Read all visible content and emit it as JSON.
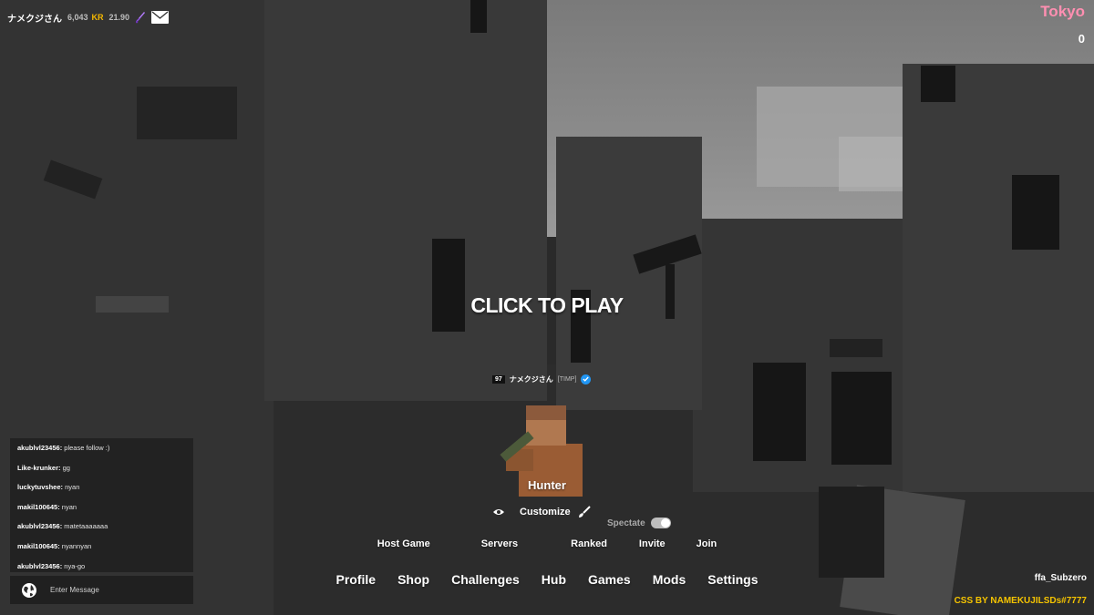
{
  "account": {
    "name": "ナメクジさん",
    "level": "6,043",
    "kr_label": "KR",
    "kr_value": "21.90",
    "icons": [
      "dagger-icon",
      "mail-icon"
    ]
  },
  "region": "Tokyo",
  "score": "0",
  "center": {
    "click_to_play": "CLICK TO PLAY",
    "player_level": "97",
    "player_name": "ナメクジさん",
    "player_clan": "[TIMP]",
    "class_name": "Hunter",
    "customize_label": "Customize",
    "spectate_label": "Spectate"
  },
  "sub_menu": [
    "Host Game",
    "Servers",
    "Ranked",
    "Invite",
    "Join"
  ],
  "main_menu": [
    "Profile",
    "Shop",
    "Challenges",
    "Hub",
    "Games",
    "Mods",
    "Settings"
  ],
  "chat": {
    "messages": [
      {
        "user": "akublvl23456:",
        "text": "please follow :)"
      },
      {
        "user": "Like-krunker:",
        "text": "gg"
      },
      {
        "user": "luckytuvshee:",
        "text": "nyan"
      },
      {
        "user": "makil100645:",
        "text": "nyan"
      },
      {
        "user": "akublvl23456:",
        "text": "matetaaaaaaa"
      },
      {
        "user": "makil100645:",
        "text": "nyannyan"
      },
      {
        "user": "akublvl23456:",
        "text": "nya-go"
      }
    ],
    "input_placeholder": "Enter Message"
  },
  "map_name": "ffa_Subzero",
  "credit": "CSS BY NAMEKUJILSDs#7777",
  "colors": {
    "region": "#ff8fb1",
    "kr": "#f5b800",
    "credit": "#f6c400",
    "verified": "#2196f3"
  }
}
